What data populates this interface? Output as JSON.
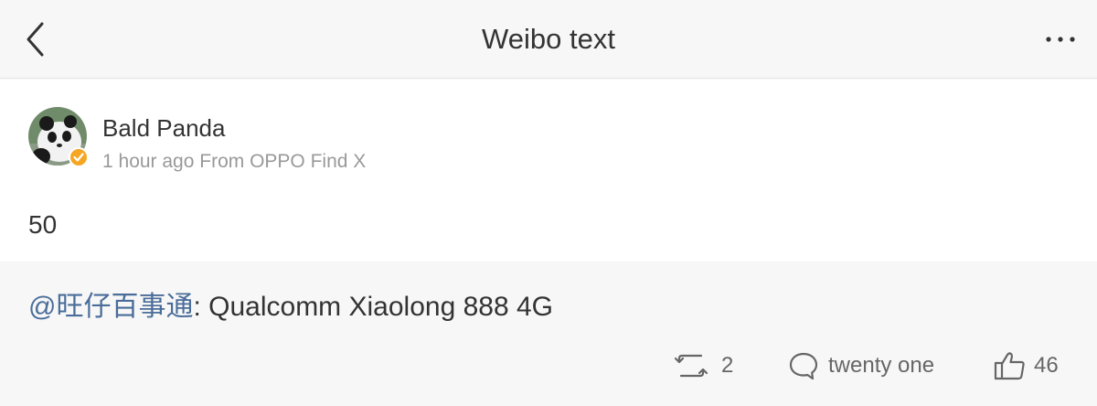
{
  "header": {
    "title": "Weibo text",
    "back_icon": "chevron-left-icon",
    "more_icon": "more-horizontal-icon"
  },
  "post": {
    "author": "Bald Panda",
    "meta": "1 hour ago From OPPO Find X",
    "text": "50",
    "verified_color": "#f5a623"
  },
  "retweet": {
    "mention": "@旺仔百事通",
    "text": ": Qualcomm Xiaolong 888 4G"
  },
  "actions": {
    "repost_count": "2",
    "comment_count": "twenty one",
    "like_count": "46"
  },
  "colors": {
    "mention_link": "#4a6d9a",
    "background": "#f7f7f7"
  }
}
